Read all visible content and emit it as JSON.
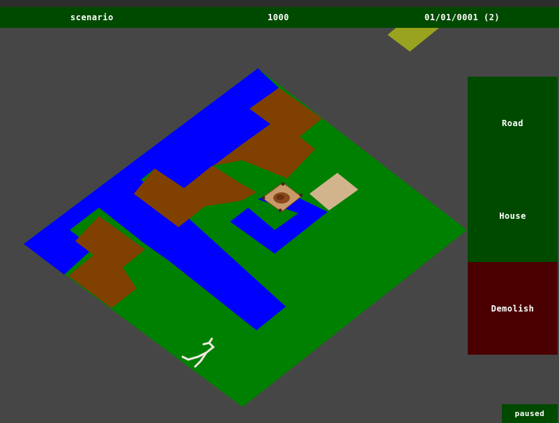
{
  "hud": {
    "scenario": "scenario",
    "money": "1000",
    "date": "01/01/0001 (2)"
  },
  "build_menu": {
    "road_label": "Road",
    "house_label": "House",
    "demolish_label": "Demolish"
  },
  "status": {
    "text": "paused"
  },
  "colors": {
    "hud_bar": "#004a00",
    "demolish": "#4a0000",
    "grass": "#008000",
    "water": "#0000ff",
    "dirt": "#804000",
    "sand": "#d2b48c",
    "background": "#464646"
  }
}
